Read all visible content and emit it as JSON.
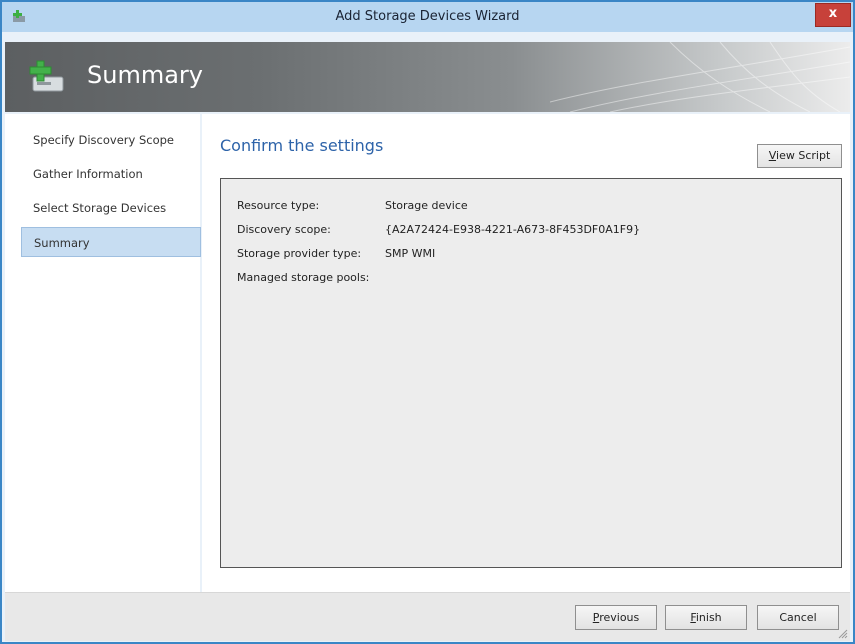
{
  "window": {
    "title": "Add Storage Devices Wizard",
    "close_label": "x",
    "accent": "#3a86c6"
  },
  "banner": {
    "title": "Summary"
  },
  "sidebar": {
    "items": [
      {
        "label": "Specify Discovery Scope",
        "active": false
      },
      {
        "label": "Gather Information",
        "active": false
      },
      {
        "label": "Select Storage Devices",
        "active": false
      },
      {
        "label": "Summary",
        "active": true
      }
    ]
  },
  "main": {
    "heading": "Confirm the settings",
    "view_script": {
      "mnemonic": "V",
      "rest": "iew Script"
    },
    "settings": [
      {
        "label": "Resource type:",
        "value": "Storage device"
      },
      {
        "label": "Discovery scope:",
        "value": "{A2A72424-E938-4221-A673-8F453DF0A1F9}"
      },
      {
        "label": "Storage provider type:",
        "value": "SMP WMI"
      },
      {
        "label": "Managed storage pools:",
        "value": ""
      }
    ]
  },
  "footer": {
    "previous": {
      "mnemonic": "P",
      "rest": "revious"
    },
    "finish": {
      "mnemonic": "F",
      "rest": "inish"
    },
    "cancel": "Cancel"
  }
}
